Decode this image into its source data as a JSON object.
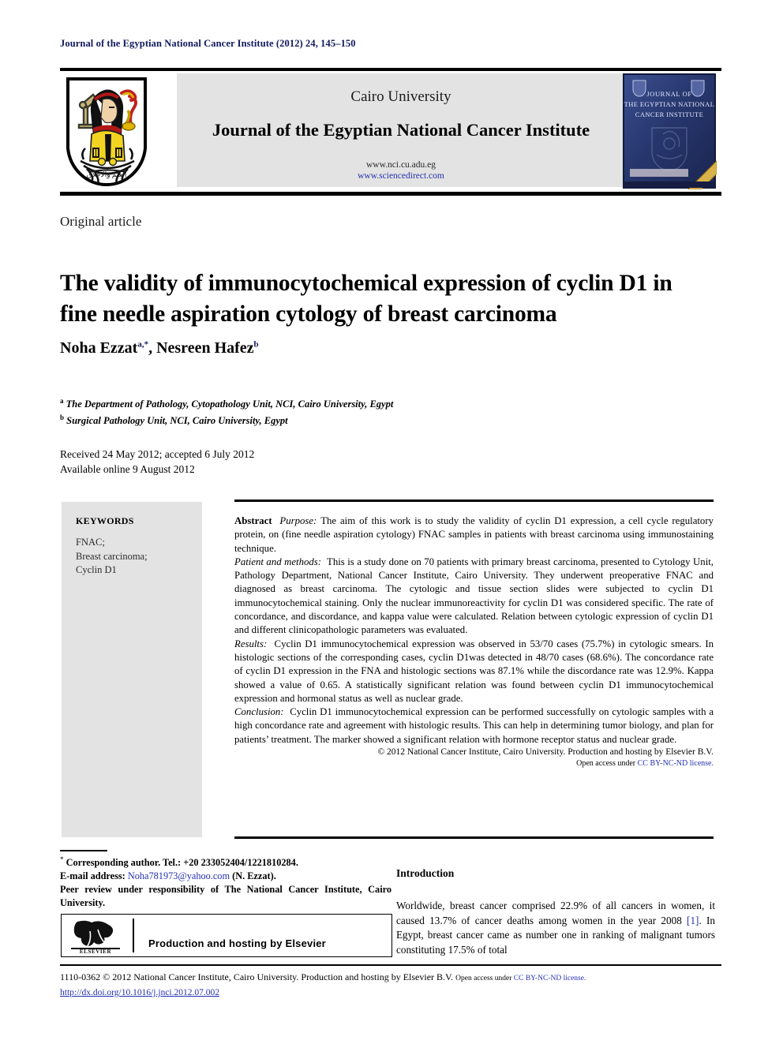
{
  "running_head": "Journal of the Egyptian National Cancer Institute (2012) 24, 145–150",
  "masthead": {
    "university": "Cairo University",
    "journal_title": "Journal of the Egyptian National Cancer Institute",
    "site_url": "www.nci.cu.adu.eg",
    "sciencedirect_url": "www.sciencedirect.com",
    "crest_alt": "cairo-university-crest",
    "cover_lines": [
      "JOURNAL OF",
      "THE EGYPTIAN NATIONAL",
      "CANCER INSTITUTE"
    ]
  },
  "article": {
    "type": "Original article",
    "title": "The validity of immunocytochemical expression of cyclin D1 in fine needle aspiration cytology of breast carcinoma",
    "authors_plain": "Noha Ezzat a,*, Nesreen Hafez b",
    "author_1": "Noha Ezzat",
    "author_1_sup": "a,*",
    "author_2": "Nesreen Hafez",
    "author_2_sup": "b",
    "affiliation_a_sup": "a",
    "affiliation_a": "The Department of Pathology, Cytopathology Unit, NCI, Cairo University, Egypt",
    "affiliation_b_sup": "b",
    "affiliation_b": "Surgical Pathology Unit, NCI, Cairo University, Egypt",
    "received": "Received 24 May 2012; accepted 6 July 2012",
    "available_online": "Available online 9 August 2012"
  },
  "keywords": {
    "heading": "KEYWORDS",
    "items": [
      "FNAC;",
      "Breast carcinoma;",
      "Cyclin D1"
    ]
  },
  "abstract": {
    "label": "Abstract",
    "purpose_label": "Purpose:",
    "purpose_text": "The aim of this work is to study the validity of cyclin D1 expression, a cell cycle regulatory protein, on (fine needle aspiration cytology) FNAC samples in patients with breast carcinoma using immunostaining technique.",
    "methods_label": "Patient and methods:",
    "methods_text": "This is a study done on 70 patients with primary breast carcinoma, presented to Cytology Unit, Pathology Department, National Cancer Institute, Cairo University. They underwent preoperative FNAC and diagnosed as breast carcinoma. The cytologic and tissue section slides were subjected to cyclin D1 immunocytochemical staining. Only the nuclear immunoreactivity for cyclin D1 was considered specific. The rate of concordance, and discordance, and kappa value were calculated. Relation between cytologic expression of cyclin D1 and different clinicopathologic parameters was evaluated.",
    "results_label": "Results:",
    "results_text": "Cyclin D1 immunocytochemical expression was observed in 53/70 cases (75.7%) in cytologic smears. In histologic sections of the corresponding cases, cyclin D1was detected in 48/70 cases (68.6%). The concordance rate of cyclin D1 expression in the FNA and histologic sections was 87.1% while the discordance rate was 12.9%. Kappa showed a value of 0.65. A statistically significant relation was found between cyclin D1 immunocytochemical expression and hormonal status as well as nuclear grade.",
    "conclusion_label": "Conclusion:",
    "conclusion_text": "Cyclin D1 immunocytochemical expression can be performed successfully on cytologic samples with a high concordance rate and agreement with histologic results. This can help in determining tumor biology, and plan for patients’ treatment. The marker showed a significant relation with hormone receptor status and nuclear grade.",
    "copyright": "© 2012 National Cancer Institute, Cairo University. Production and hosting by Elsevier B.V.",
    "open_access_prefix": "Open access under ",
    "open_access_link": "CC BY-NC-ND license."
  },
  "footnote": {
    "star": "*",
    "corresponding": "Corresponding author. Tel.: +20 233052404/1221810284.",
    "email_label": "E-mail address:",
    "email": "Noha781973@yahoo.com",
    "email_suffix": "(N. Ezzat).",
    "peer_review": "Peer review under responsibility of The National Cancer Institute, Cairo University.",
    "elsevier_banner": "Production and hosting by Elsevier",
    "elsevier_wordmark": "ELSEVIER"
  },
  "introduction": {
    "heading": "Introduction",
    "text_part1": "Worldwide, breast cancer comprised 22.9% of all cancers in women, it caused 13.7% of cancer deaths among women in the year 2008 ",
    "ref": "[1]",
    "text_part2": ". In Egypt, breast cancer came as number one in ranking of malignant tumors constituting 17.5% of total"
  },
  "page_footer": {
    "issn_copyright": "1110-0362 © 2012 National Cancer Institute, Cairo University. Production and hosting by Elsevier B.V.",
    "open_access_prefix": "Open access under ",
    "open_access_link": "CC BY-NC-ND license.",
    "doi": "http://dx.doi.org/10.1016/j.jnci.2012.07.002"
  },
  "colors": {
    "running_head": "#101a5e",
    "link": "#2431b0",
    "banner_bg": "#e3e3e3",
    "keyword_bg": "#e3e3e3",
    "cover_blue": "#2b3f7e"
  }
}
